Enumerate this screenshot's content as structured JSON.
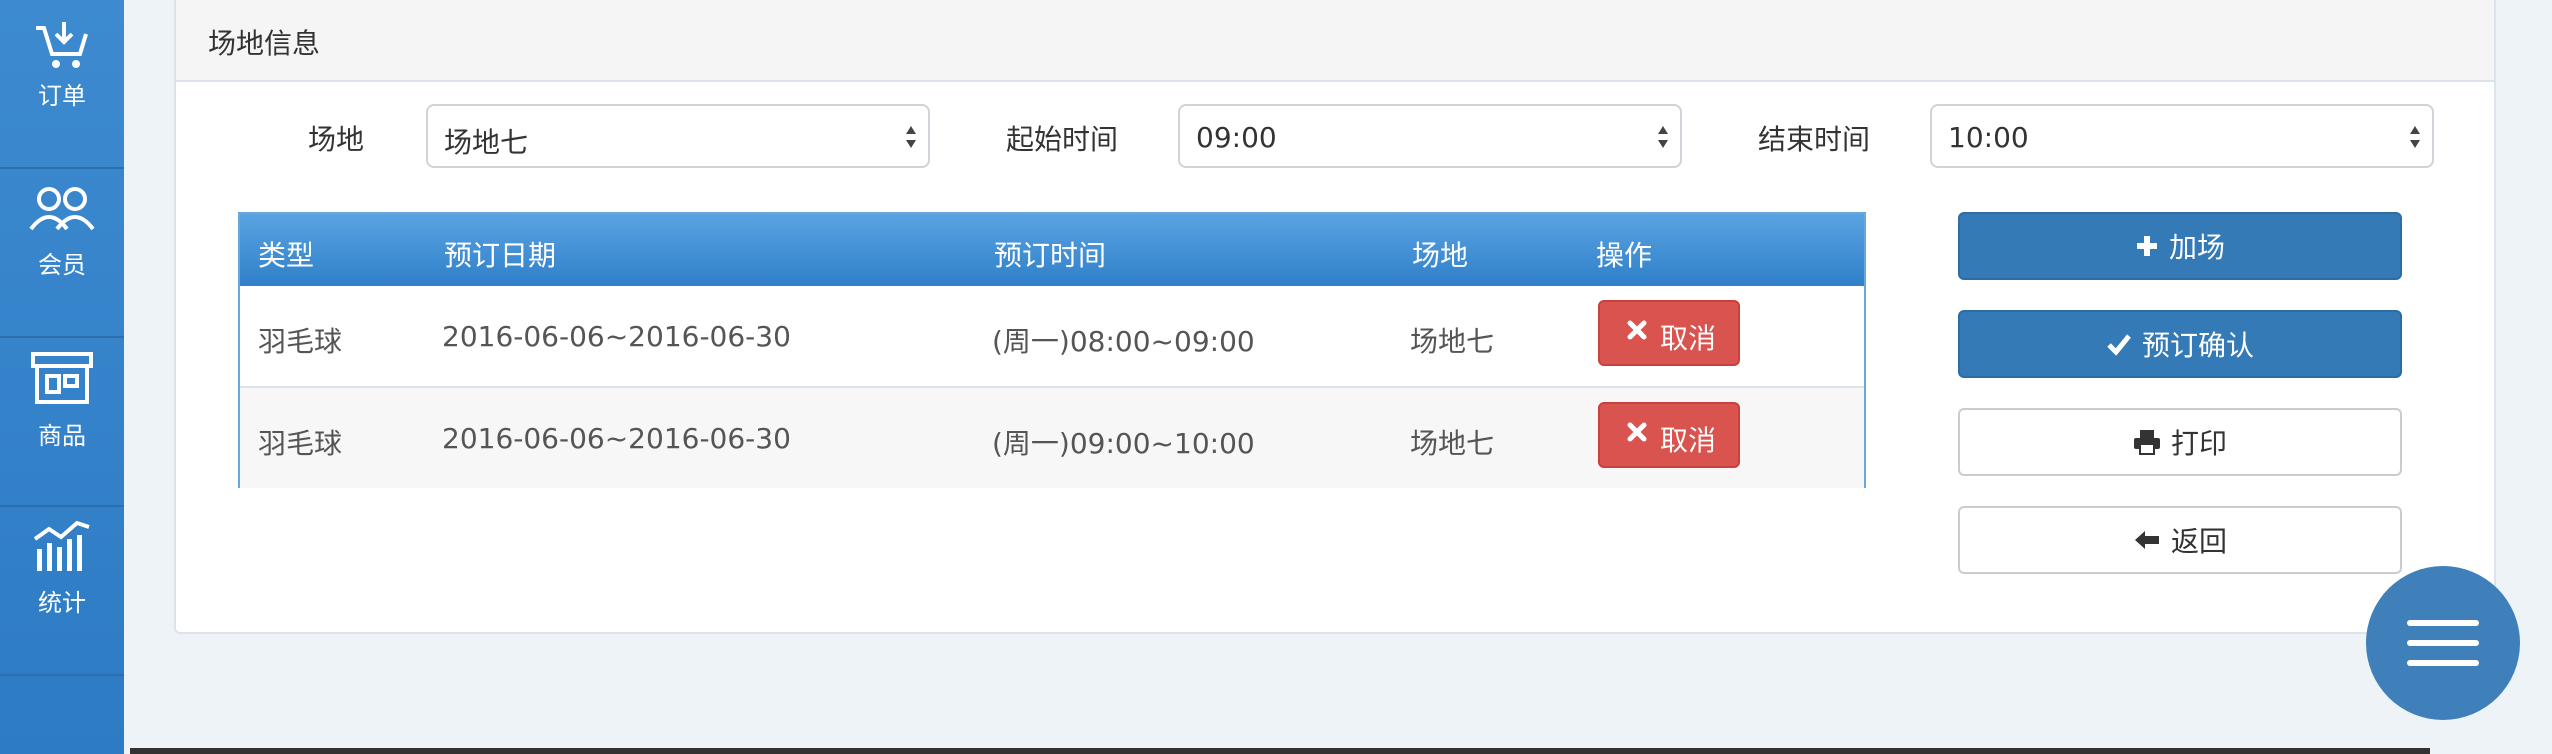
{
  "sidebar": {
    "items": [
      {
        "label": "订单",
        "icon": "cart-icon"
      },
      {
        "label": "会员",
        "icon": "members-icon"
      },
      {
        "label": "商品",
        "icon": "store-icon"
      },
      {
        "label": "统计",
        "icon": "stats-icon"
      }
    ]
  },
  "panel": {
    "title": "场地信息",
    "venue_label": "场地",
    "venue_value": "场地七",
    "start_label": "起始时间",
    "start_value": "09:00",
    "end_label": "结束时间",
    "end_value": "10:00"
  },
  "table": {
    "headers": [
      "类型",
      "预订日期",
      "预订时间",
      "场地",
      "操作"
    ],
    "rows": [
      {
        "type": "羽毛球",
        "date": "2016-06-06~2016-06-30",
        "time": "(周一)08:00~09:00",
        "venue": "场地七",
        "action": "取消"
      },
      {
        "type": "羽毛球",
        "date": "2016-06-06~2016-06-30",
        "time": "(周一)09:00~10:00",
        "venue": "场地七",
        "action": "取消"
      }
    ]
  },
  "actions": {
    "add": "加场",
    "confirm": "预订确认",
    "print": "打印",
    "back": "返回"
  },
  "colors": {
    "primary": "#337ab7",
    "danger": "#d9534f",
    "sidebar": "#3d8ad0"
  }
}
